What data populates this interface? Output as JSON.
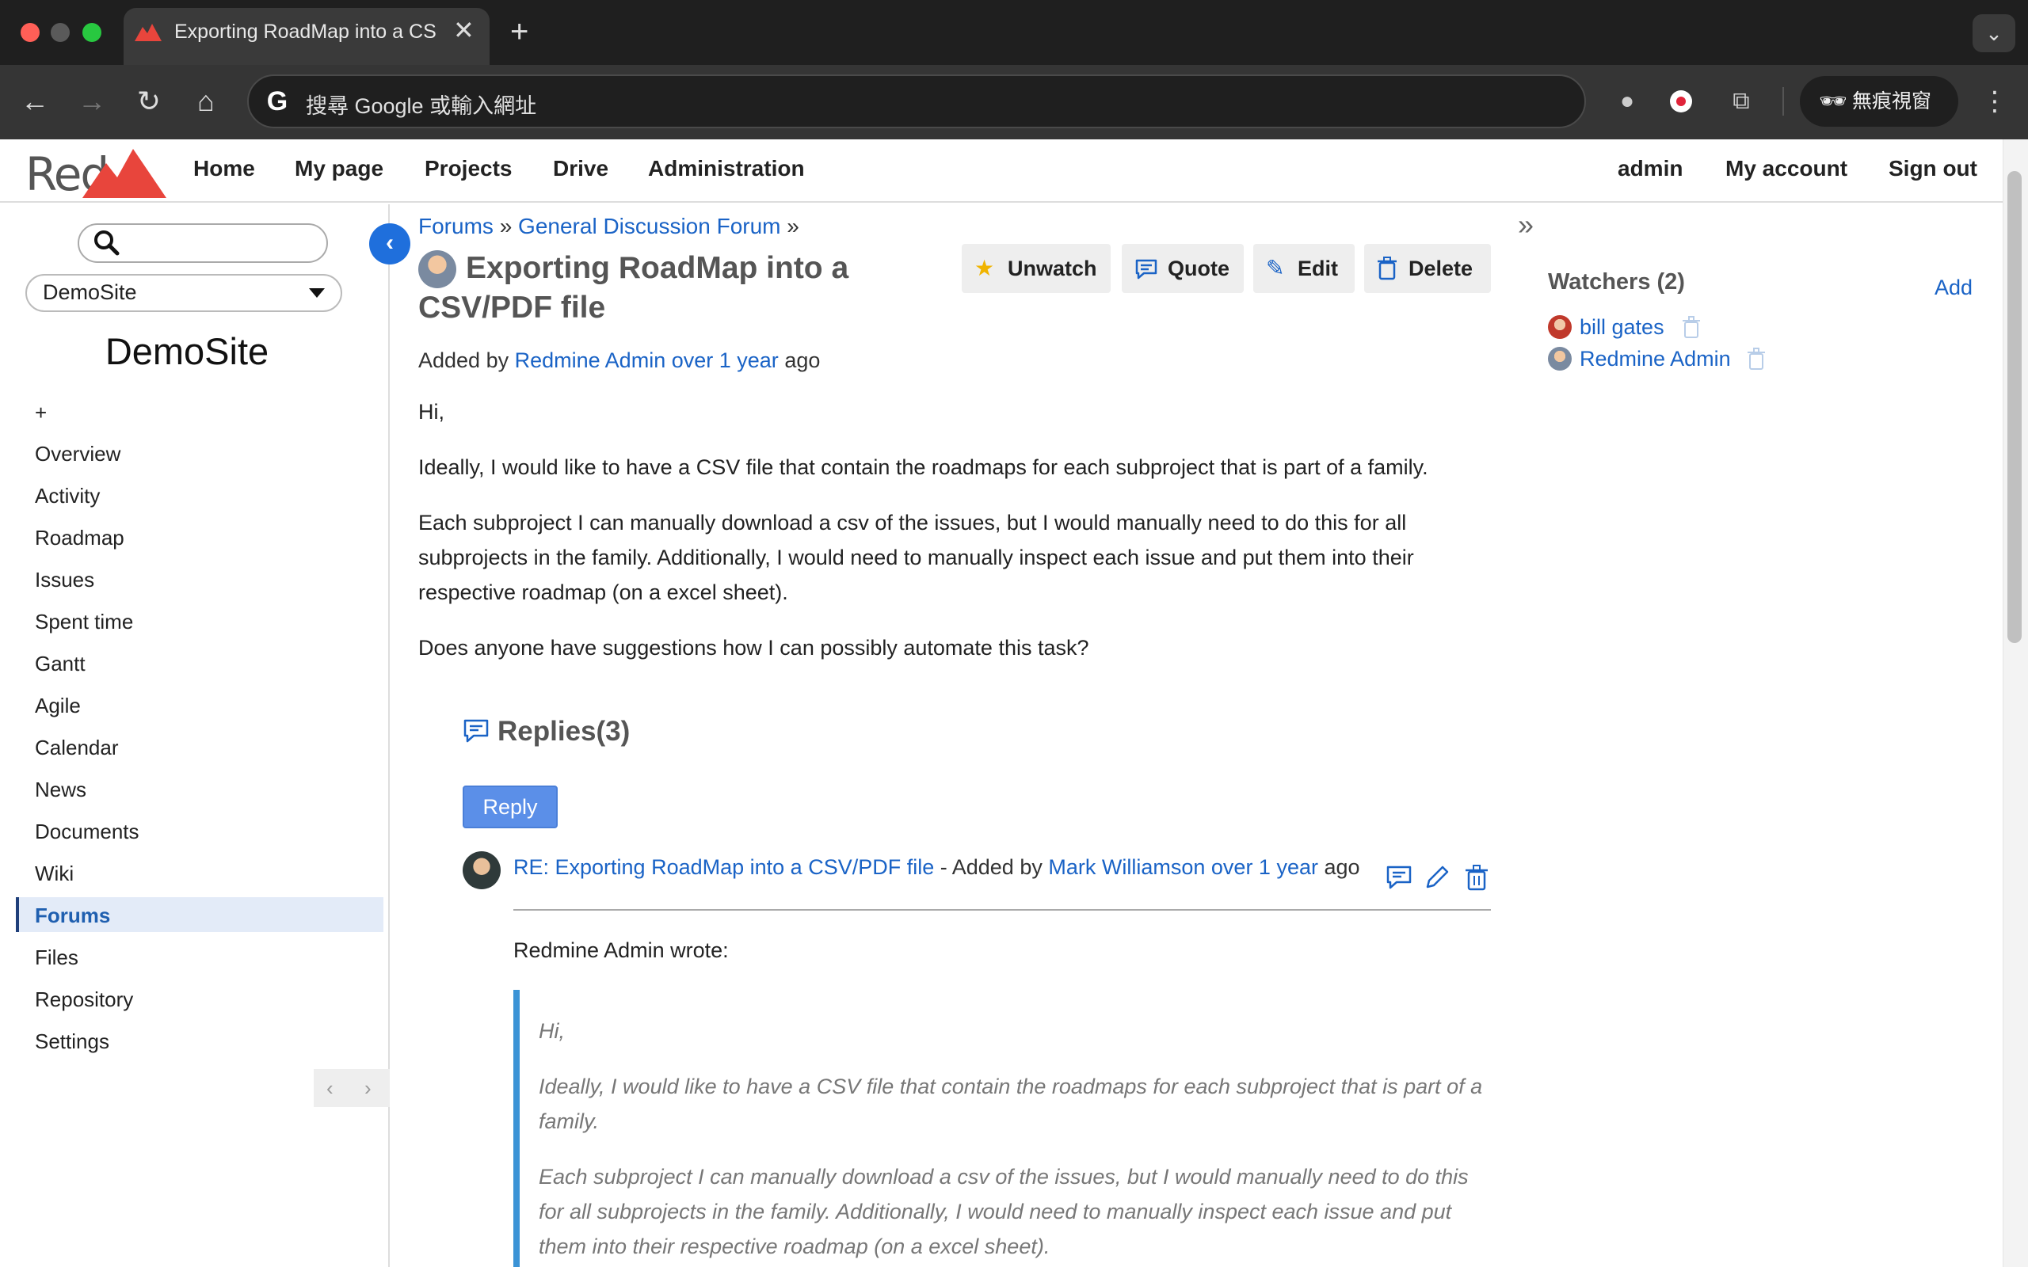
{
  "browser": {
    "tab_title": "Exporting RoadMap into a CSV/PDF file",
    "tab_close": "✕",
    "new_tab": "+",
    "omnibox_text": "搜尋 Google 或輸入網址",
    "incognito_label": "無痕視窗"
  },
  "header": {
    "logo_text": "Red",
    "nav": [
      "Home",
      "My page",
      "Projects",
      "Drive",
      "Administration"
    ],
    "account": [
      "admin",
      "My account",
      "Sign out"
    ]
  },
  "sidebar": {
    "project_select": "DemoSite",
    "project_name": "DemoSite",
    "menu": [
      "+",
      "Overview",
      "Activity",
      "Roadmap",
      "Issues",
      "Spent time",
      "Gantt",
      "Agile",
      "Calendar",
      "News",
      "Documents",
      "Wiki",
      "Forums",
      "Files",
      "Repository",
      "Settings"
    ],
    "active": "Forums"
  },
  "breadcrumb": {
    "forums": "Forums",
    "sep": "»",
    "board": "General Discussion Forum"
  },
  "topic": {
    "title": "Exporting RoadMap into a CSV/PDF file",
    "actions": [
      "Unwatch",
      "Quote",
      "Edit",
      "Delete"
    ],
    "byline_prefix": "Added by",
    "author": "Redmine Admin",
    "age": "over 1 year",
    "byline_suffix": "ago",
    "body": [
      "Hi,",
      "Ideally, I would like to have a CSV file that contain the roadmaps for each subproject that is part of a family.",
      "Each subproject I can manually download a csv of the issues, but I would manually need to do this for all subprojects in the family. Additionally, I would need to manually inspect each issue and put them into their respective roadmap (on a excel sheet).",
      "Does anyone have suggestions how I can possibly automate this task?"
    ]
  },
  "replies": {
    "title": "Replies(3)",
    "reply_button": "Reply",
    "items": [
      {
        "subject": "RE: Exporting RoadMap into a CSV/PDF file",
        "added_by": "- Added by",
        "author": "Mark Williamson",
        "age": "over 1 year",
        "age_suffix": "ago",
        "wrote": "Redmine Admin wrote:",
        "quote": [
          "Hi,",
          "Ideally, I would like to have a CSV file that contain the roadmaps for each subproject that is part of a family.",
          "Each subproject I can manually download a csv of the issues, but I would manually need to do this for all subprojects in the family. Additionally, I would need to manually inspect each issue and put them into their respective roadmap (on a excel sheet)."
        ]
      }
    ]
  },
  "watchers": {
    "title": "Watchers (2)",
    "add": "Add",
    "items": [
      "bill gates",
      "Redmine Admin"
    ]
  },
  "colors": {
    "link": "#1a63c6",
    "accent": "#1f6fdc",
    "quote_bar": "#3b93d6",
    "active_menu_bg": "#e3ebf8"
  }
}
